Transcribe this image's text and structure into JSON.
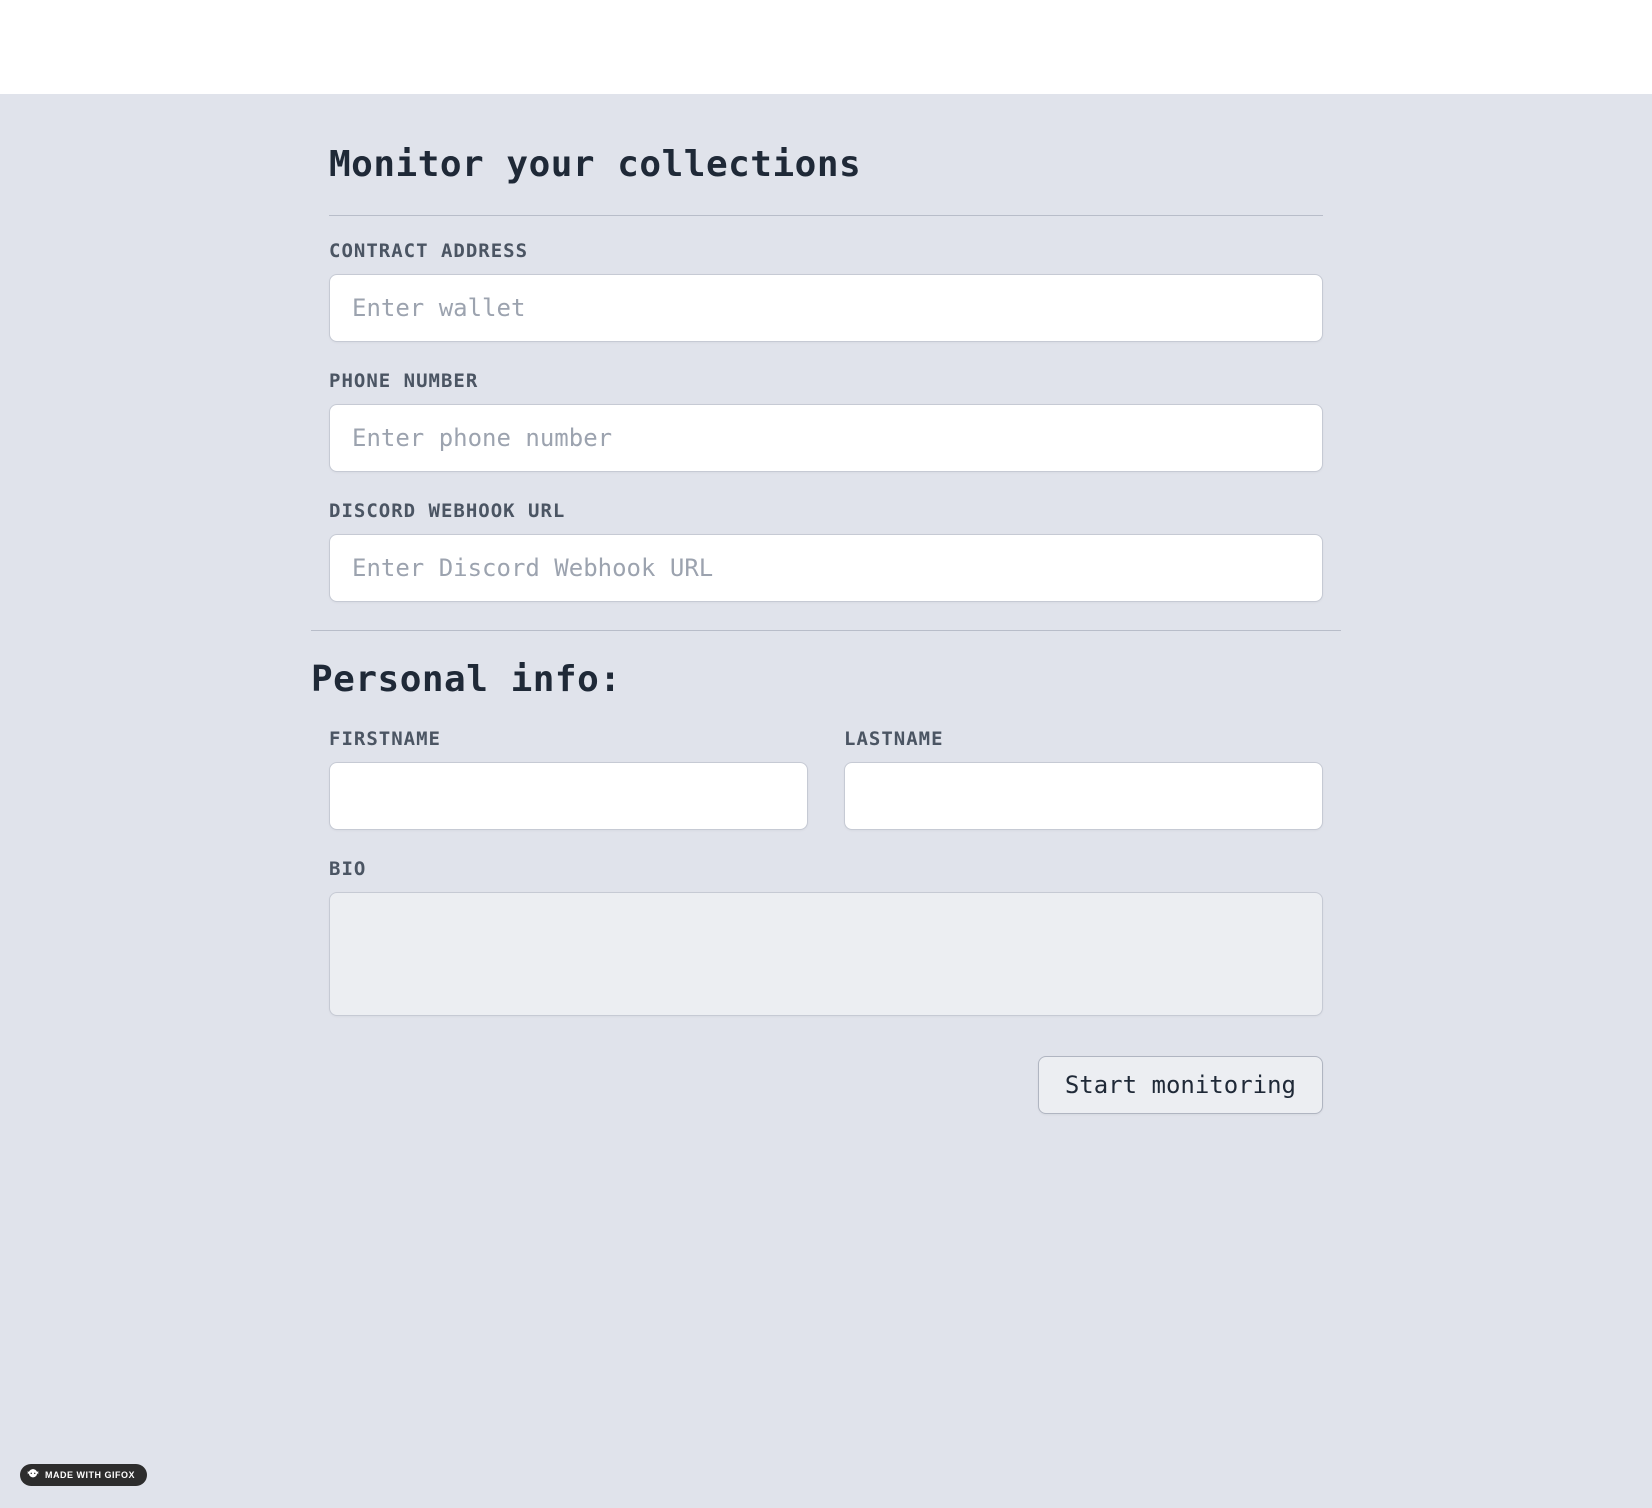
{
  "header": {
    "title": "Monitor your collections"
  },
  "form": {
    "contract_address": {
      "label": "CONTRACT ADDRESS",
      "placeholder": "Enter wallet",
      "value": ""
    },
    "phone_number": {
      "label": "PHONE NUMBER",
      "placeholder": "Enter phone number",
      "value": ""
    },
    "discord_webhook": {
      "label": "DISCORD WEBHOOK URL",
      "placeholder": "Enter Discord Webhook URL",
      "value": ""
    }
  },
  "personal": {
    "heading": "Personal info:",
    "firstname": {
      "label": "FIRSTNAME",
      "value": ""
    },
    "lastname": {
      "label": "LASTNAME",
      "value": ""
    },
    "bio": {
      "label": "BIO",
      "value": ""
    }
  },
  "actions": {
    "submit_label": "Start monitoring"
  },
  "badge": {
    "text": "MADE WITH GIFOX"
  }
}
